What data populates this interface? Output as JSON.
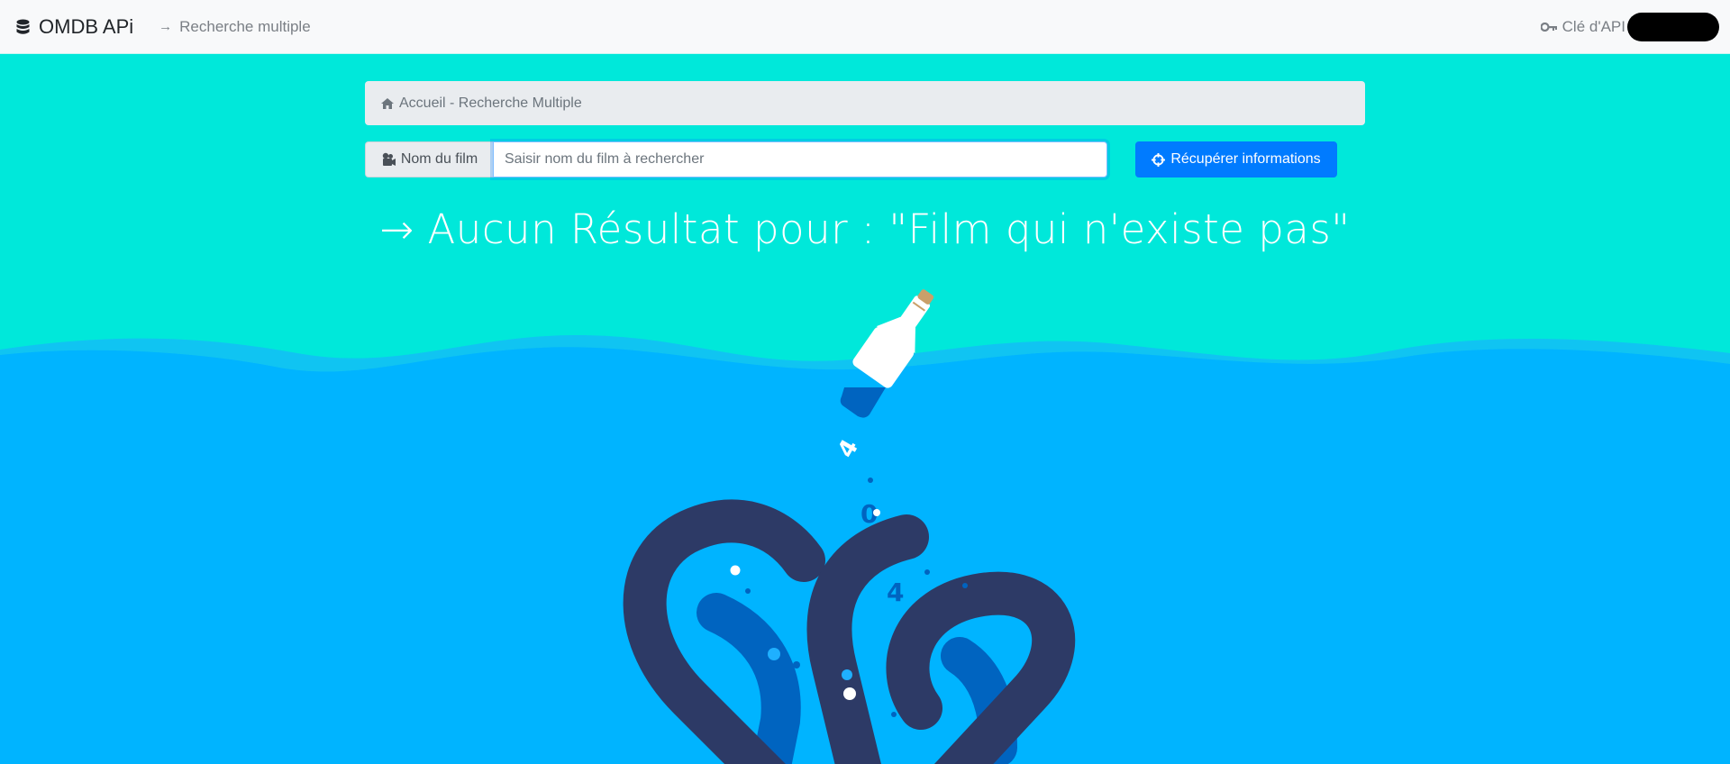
{
  "navbar": {
    "brand": "OMDB APi",
    "brand_icon": "database-icon",
    "nav_link": "Recherche multiple",
    "api_key_label": "Clé d'API",
    "api_key_icon": "key-icon"
  },
  "breadcrumb": {
    "icon": "home-icon",
    "text": "Accueil - Recherche Multiple"
  },
  "search": {
    "label": "Nom du film",
    "label_icon": "video-camera-icon",
    "value": "",
    "placeholder": "Saisir nom du film à rechercher",
    "button_label": "Récupérer informations",
    "button_icon": "crosshairs-icon"
  },
  "result": {
    "heading": "Aucun Résultat pour : \"Film qui n'existe pas\""
  },
  "illustration": {
    "digits": [
      "4",
      "0",
      "4"
    ]
  },
  "colors": {
    "sky": "#00e8da",
    "water": "#00b4ff",
    "tentacle": "#2d3a66",
    "tentacle_inner": "#0064c0",
    "primary": "#007bff"
  }
}
